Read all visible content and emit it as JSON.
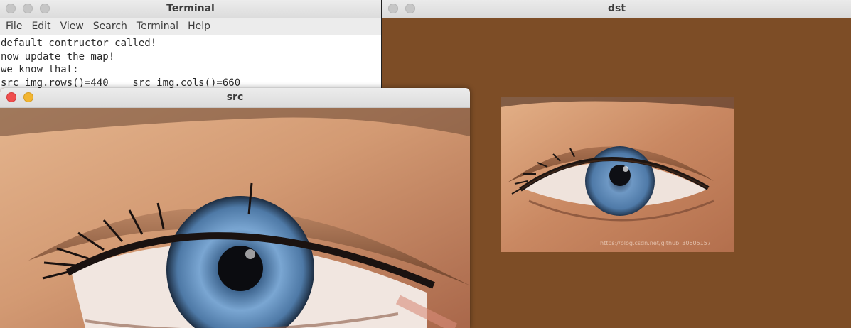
{
  "terminal": {
    "title": "Terminal",
    "menu": [
      "File",
      "Edit",
      "View",
      "Search",
      "Terminal",
      "Help"
    ],
    "lines": [
      "default contructor called!",
      "now update the map!",
      "we know that:",
      "src img.rows()=440    src img.cols()=660"
    ]
  },
  "dst": {
    "title": "dst",
    "watermark": "https://blog.csdn.net/github_30605157",
    "background_color": "#7d4d26"
  },
  "src": {
    "title": "src"
  },
  "colors": {
    "close_button": "#ef4e4e",
    "minimize_button": "#f2b531",
    "inactive_button": "#c6c6c6",
    "iris": "#5b86b5"
  }
}
